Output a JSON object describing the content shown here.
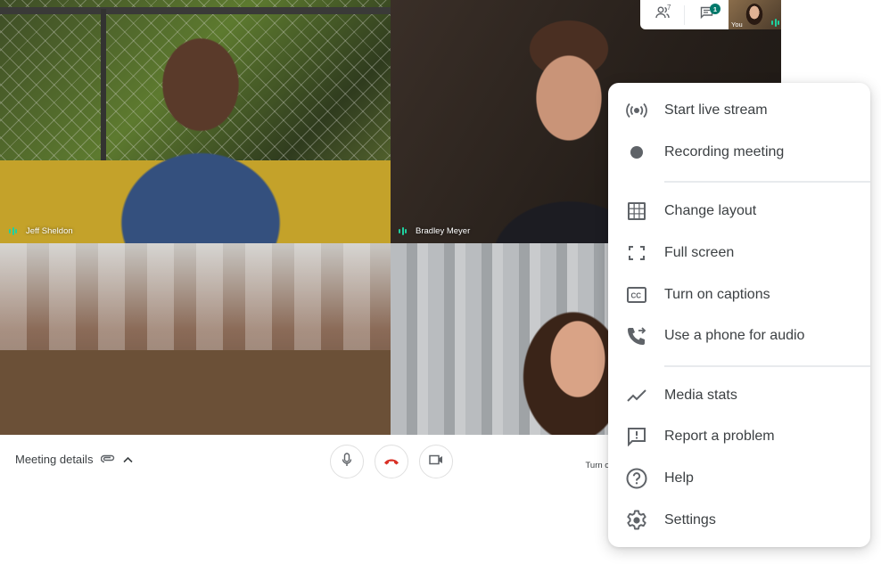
{
  "participants": [
    {
      "name": "Jeff Sheldon"
    },
    {
      "name": "Bradley Meyer"
    },
    {
      "name": ""
    },
    {
      "name": ""
    }
  ],
  "top_panel": {
    "people_icon": "people-icon",
    "people_count": "7",
    "chat_icon": "chat-icon",
    "chat_badge": "1",
    "self_label": "You"
  },
  "bottom_bar": {
    "meeting_details_label": "Meeting details",
    "attachment_icon": "attachment-icon",
    "expand_icon": "chevron-up-icon",
    "mic_icon": "microphone-icon",
    "hangup_icon": "hang-up-icon",
    "camera_icon": "camera-icon",
    "captions_label": "Turn on ca"
  },
  "menu": {
    "groups": [
      [
        {
          "icon": "live-stream-icon",
          "label": "Start live stream"
        },
        {
          "icon": "record-dot-icon",
          "label": "Recording meeting"
        }
      ],
      [
        {
          "icon": "grid-layout-icon",
          "label": "Change layout"
        },
        {
          "icon": "fullscreen-icon",
          "label": "Full screen"
        },
        {
          "icon": "captions-icon",
          "label": "Turn on captions"
        },
        {
          "icon": "phone-forward-icon",
          "label": "Use a phone for audio"
        }
      ],
      [
        {
          "icon": "stats-icon",
          "label": "Media stats"
        },
        {
          "icon": "report-problem-icon",
          "label": "Report a problem"
        },
        {
          "icon": "help-icon",
          "label": "Help"
        },
        {
          "icon": "settings-gear-icon",
          "label": "Settings"
        }
      ]
    ]
  },
  "colors": {
    "speaking_indicator": "#1ed1a0",
    "hangup_red": "#d93025",
    "chat_badge": "#00796b",
    "icon_gray": "#5f6368"
  }
}
